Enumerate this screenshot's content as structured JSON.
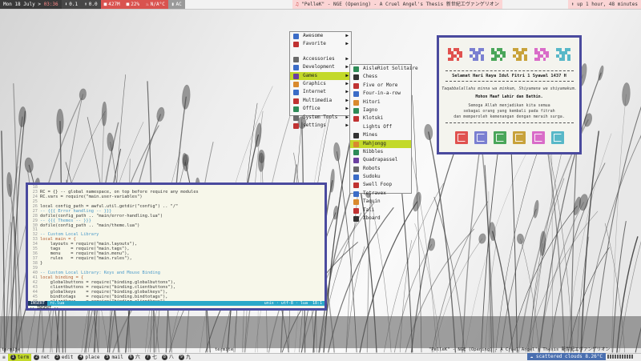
{
  "topbar": {
    "date": "Mon 18 July",
    "time": "03:36",
    "stats": [
      "0.1",
      "0.0",
      "427M",
      "22%",
      "N/A°C",
      "AC"
    ],
    "song": "\"PelleK\" - NGE (Opening) - A Cruel Angel's Thesis 新世紀エヴァンゲリオン",
    "uptime": "up 1 hour, 48 minutes"
  },
  "main_menu": {
    "items": [
      {
        "label": "Awesome",
        "color": "#3b6cc7",
        "arrow": true
      },
      {
        "label": "Favorite",
        "color": "#c03232",
        "arrow": true
      },
      {
        "label": "",
        "sep": true
      },
      {
        "label": "Accessories",
        "color": "#6a6a6a",
        "arrow": true
      },
      {
        "label": "Development",
        "color": "#3b6cc7",
        "arrow": true
      },
      {
        "label": "Games",
        "color": "#6b3fa0",
        "arrow": true,
        "selected": true
      },
      {
        "label": "Graphics",
        "color": "#d98a2e",
        "arrow": true
      },
      {
        "label": "Internet",
        "color": "#3b6cc7",
        "arrow": true
      },
      {
        "label": "Multimedia",
        "color": "#c03232",
        "arrow": true
      },
      {
        "label": "Office",
        "color": "#2e8b57",
        "arrow": true
      },
      {
        "label": "System Tools",
        "color": "#6a6a6a",
        "arrow": true
      },
      {
        "label": "settings",
        "color": "#c03232",
        "arrow": true
      }
    ]
  },
  "games_menu": {
    "items": [
      {
        "label": "AisleRiot Solitaire",
        "color": "#2e8b57"
      },
      {
        "label": "Chess",
        "color": "#333333"
      },
      {
        "label": "Five or More",
        "color": "#c03232"
      },
      {
        "label": "Four-in-a-row",
        "color": "#3b6cc7"
      },
      {
        "label": "Hitori",
        "color": "#d98a2e"
      },
      {
        "label": "Iagno",
        "color": "#2e8b57"
      },
      {
        "label": "Klotski",
        "color": "#c03232"
      },
      {
        "label": "Lights Off",
        "color": "#f7f7f7"
      },
      {
        "label": "Mines",
        "color": "#333333"
      },
      {
        "label": "Mahjongg",
        "color": "#d98a2e",
        "selected": true
      },
      {
        "label": "Nibbles",
        "color": "#2e8b57"
      },
      {
        "label": "Quadrapassel",
        "color": "#6b3fa0"
      },
      {
        "label": "Robots",
        "color": "#6a6a6a"
      },
      {
        "label": "Sudoku",
        "color": "#3b6cc7"
      },
      {
        "label": "Swell Foop",
        "color": "#c03232"
      },
      {
        "label": "Tetravex",
        "color": "#3b6cc7"
      },
      {
        "label": "Taquin",
        "color": "#d98a2e"
      },
      {
        "label": "Tali",
        "color": "#c03232"
      },
      {
        "label": "Xboard",
        "color": "#333333"
      }
    ]
  },
  "card": {
    "title": "Selamat Hari Raya Idul Fitri 1 Syawal 1437 H",
    "line1": "Taqabbalallahu minna wa minkum, Shiyamana wa shiyamakum.",
    "line2": "Mohon Maaf Lahir dan Bathin.",
    "line3": "Semoga Allah menjadikan kita semua",
    "line4": "sebagai orang yang kembali pada fitrah",
    "line5": "dan memperoleh kemenangan dengan meraih surga.",
    "colors": [
      "#e0524f",
      "#7a7fd1",
      "#4aa65a",
      "#c8a23a",
      "#d96cc8",
      "#58b8c8"
    ]
  },
  "editor": {
    "lines": [
      {
        "n": "18",
        "t": "",
        "k": "text"
      },
      {
        "n": "23",
        "t": "RC = {} -- global namespace, on top before require any modules",
        "k": "text"
      },
      {
        "n": "24",
        "t": "RC.vars = require(\"main.user-variables\")",
        "k": "text"
      },
      {
        "n": "25",
        "t": "",
        "k": "text"
      },
      {
        "n": "26",
        "t": "local config_path = awful.util.getdir(\"config\") .. \"/\"",
        "k": "text"
      },
      {
        "n": "27",
        "t": "-- {{{ Error handling -- }}}",
        "k": "cm"
      },
      {
        "n": "28",
        "t": "dofile(config_path .. \"main/error-handling.lua\")",
        "k": "text"
      },
      {
        "n": "29",
        "t": "-- {{{ Themes -- }}}",
        "k": "cm"
      },
      {
        "n": "30",
        "t": "dofile(config_path .. \"main/theme.lua\")",
        "k": "text"
      },
      {
        "n": "31",
        "t": "",
        "k": "text"
      },
      {
        "n": "32",
        "t": "-- Custom Local Library",
        "k": "cm"
      },
      {
        "n": "33",
        "t": "local main = {",
        "k": "kw"
      },
      {
        "n": "34",
        "t": "    layouts = require(\"main.layouts\"),",
        "k": "text"
      },
      {
        "n": "35",
        "t": "    tags    = require(\"main.tags\"),",
        "k": "text"
      },
      {
        "n": "36",
        "t": "    menu    = require(\"main.menu\"),",
        "k": "text"
      },
      {
        "n": "37",
        "t": "    rules   = require(\"main.rules\"),",
        "k": "text"
      },
      {
        "n": "38",
        "t": "}",
        "k": "text"
      },
      {
        "n": "39",
        "t": "",
        "k": "text"
      },
      {
        "n": "40",
        "t": "-- Custom Local Library: Keys and Mouse Binding",
        "k": "cm"
      },
      {
        "n": "41",
        "t": "local binding = {",
        "k": "kw"
      },
      {
        "n": "42",
        "t": "    globalbuttons = require(\"binding.globalbuttons\"),",
        "k": "text"
      },
      {
        "n": "43",
        "t": "    clientbuttons = require(\"binding.clientbuttons\"),",
        "k": "text"
      },
      {
        "n": "44",
        "t": "    globalkeys    = require(\"binding.globalkeys\"),",
        "k": "text"
      },
      {
        "n": "45",
        "t": "    bindtotags    = require(\"binding.bindtotags\"),",
        "k": "text"
      },
      {
        "n": "46",
        "t": "    clientkeys    = require(\"binding.clientkeys\")",
        "k": "text"
      }
    ],
    "status": {
      "mode": "INSERT",
      "file": "rc.lua",
      "enc": "unix · utf-8 · lua",
      "pos": "18:1"
    },
    "cmd": "-- INSERT --"
  },
  "bottombar": {
    "term_top": "termite",
    "term_center": "termite",
    "song": "\"PelleK\" - NGE (Opening) - A Cruel Angel's Thesis 新世紀エヴァンゲリオン",
    "tags": [
      {
        "num": "1",
        "label": "term",
        "active": true
      },
      {
        "num": "2",
        "label": "net"
      },
      {
        "num": "3",
        "label": "edit"
      },
      {
        "num": "4",
        "label": "place"
      },
      {
        "num": "5",
        "label": "mail"
      },
      {
        "num": "6",
        "label": "六"
      },
      {
        "num": "7",
        "label": "七"
      },
      {
        "num": "8",
        "label": "八"
      },
      {
        "num": "9",
        "label": "九"
      }
    ],
    "weather": "scattered clouds 8.26°C"
  }
}
